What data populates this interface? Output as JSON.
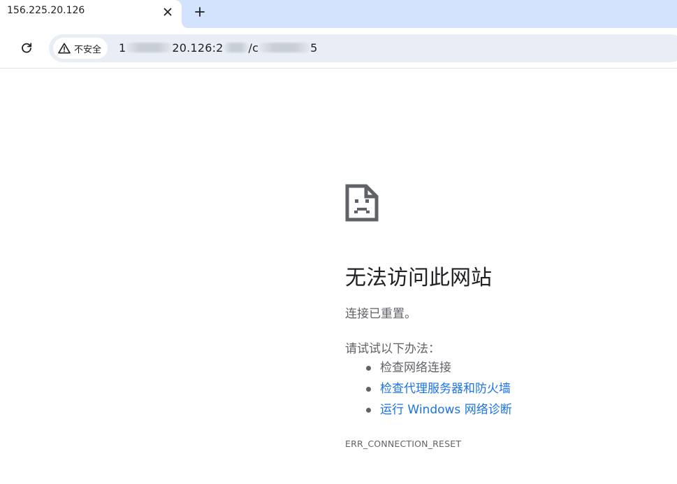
{
  "tab": {
    "title": "156.225.20.126",
    "close_icon": "close-icon",
    "new_tab_icon": "plus-icon"
  },
  "toolbar": {
    "reload_icon": "reload-icon",
    "security": {
      "icon": "warning-triangle-icon",
      "label": "不安全"
    },
    "url": {
      "part1": "1",
      "part2": "20.126:2",
      "part3": "/c",
      "part4": "5"
    }
  },
  "error_page": {
    "icon": "sad-page-icon",
    "title": "无法访问此网站",
    "description": "连接已重置。",
    "try_label": "请试试以下办法：",
    "suggestions": [
      {
        "text": "检查网络连接",
        "link": false
      },
      {
        "text": "检查代理服务器和防火墙",
        "link": true
      },
      {
        "text": "运行 Windows 网络诊断",
        "link": true
      }
    ],
    "error_code": "ERR_CONNECTION_RESET"
  },
  "colors": {
    "tabstrip_bg": "#d3e3fd",
    "omnibox_bg": "#e9eef6",
    "link": "#1a73e8",
    "secondary_text": "#5f6368"
  }
}
